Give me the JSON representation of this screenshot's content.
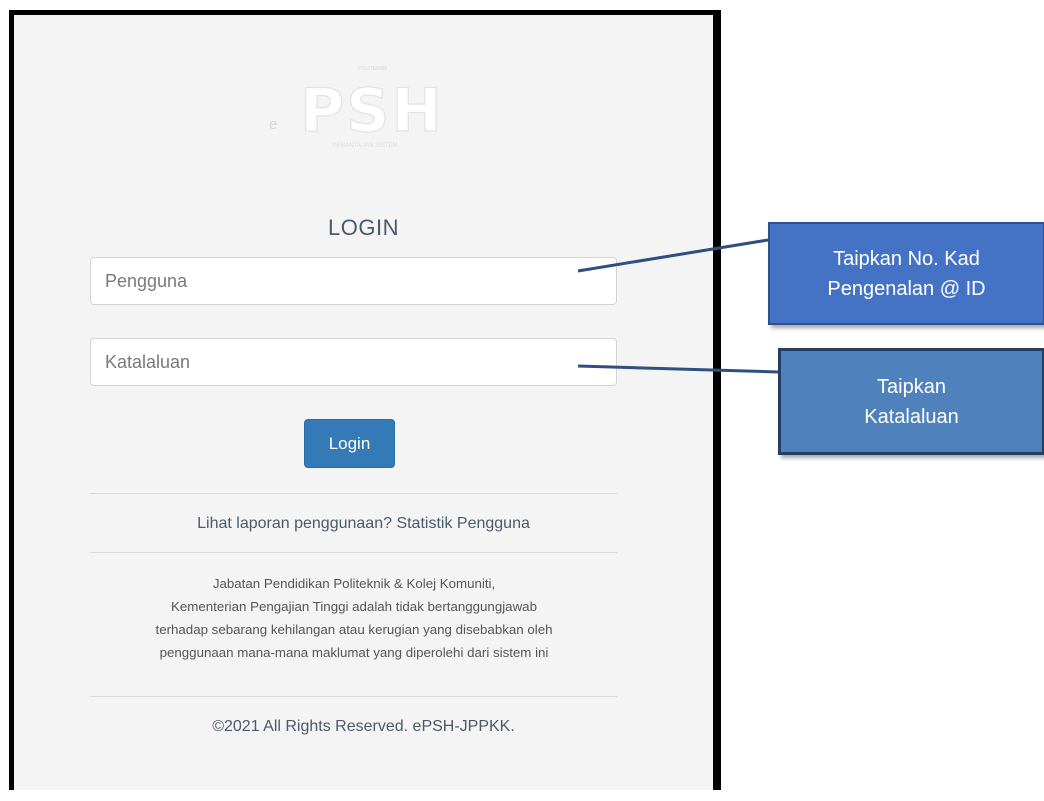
{
  "logo": {
    "small_top": "POLITEKNIK",
    "prefix": "e",
    "main": "PSH",
    "small_bottom": "PEMANTAUAN SISTEM"
  },
  "login": {
    "title": "LOGIN",
    "username_placeholder": "Pengguna",
    "password_placeholder": "Katalaluan",
    "button_label": "Login"
  },
  "report": {
    "question": "Lihat laporan penggunaan?",
    "link": "Statistik Pengguna"
  },
  "disclaimer": {
    "lines": [
      "Jabatan Pendidikan Politeknik & Kolej Komuniti,",
      "Kementerian Pengajian Tinggi adalah tidak bertanggungjawab",
      "terhadap sebarang kehilangan atau kerugian yang disebabkan oleh",
      "penggunaan mana-mana maklumat yang diperolehi dari sistem ini"
    ]
  },
  "footer": {
    "copyright": "©2021 All Rights Reserved. ePSH-JPPKK."
  },
  "callouts": {
    "username_hint": [
      "Taipkan No. Kad",
      "Pengenalan @ ID"
    ],
    "password_hint": [
      "Taipkan",
      "Katalaluan"
    ]
  },
  "colors": {
    "primary_button": "#337ab7",
    "callout_blue": "#4472c4",
    "connector": "#2f4f7f"
  }
}
